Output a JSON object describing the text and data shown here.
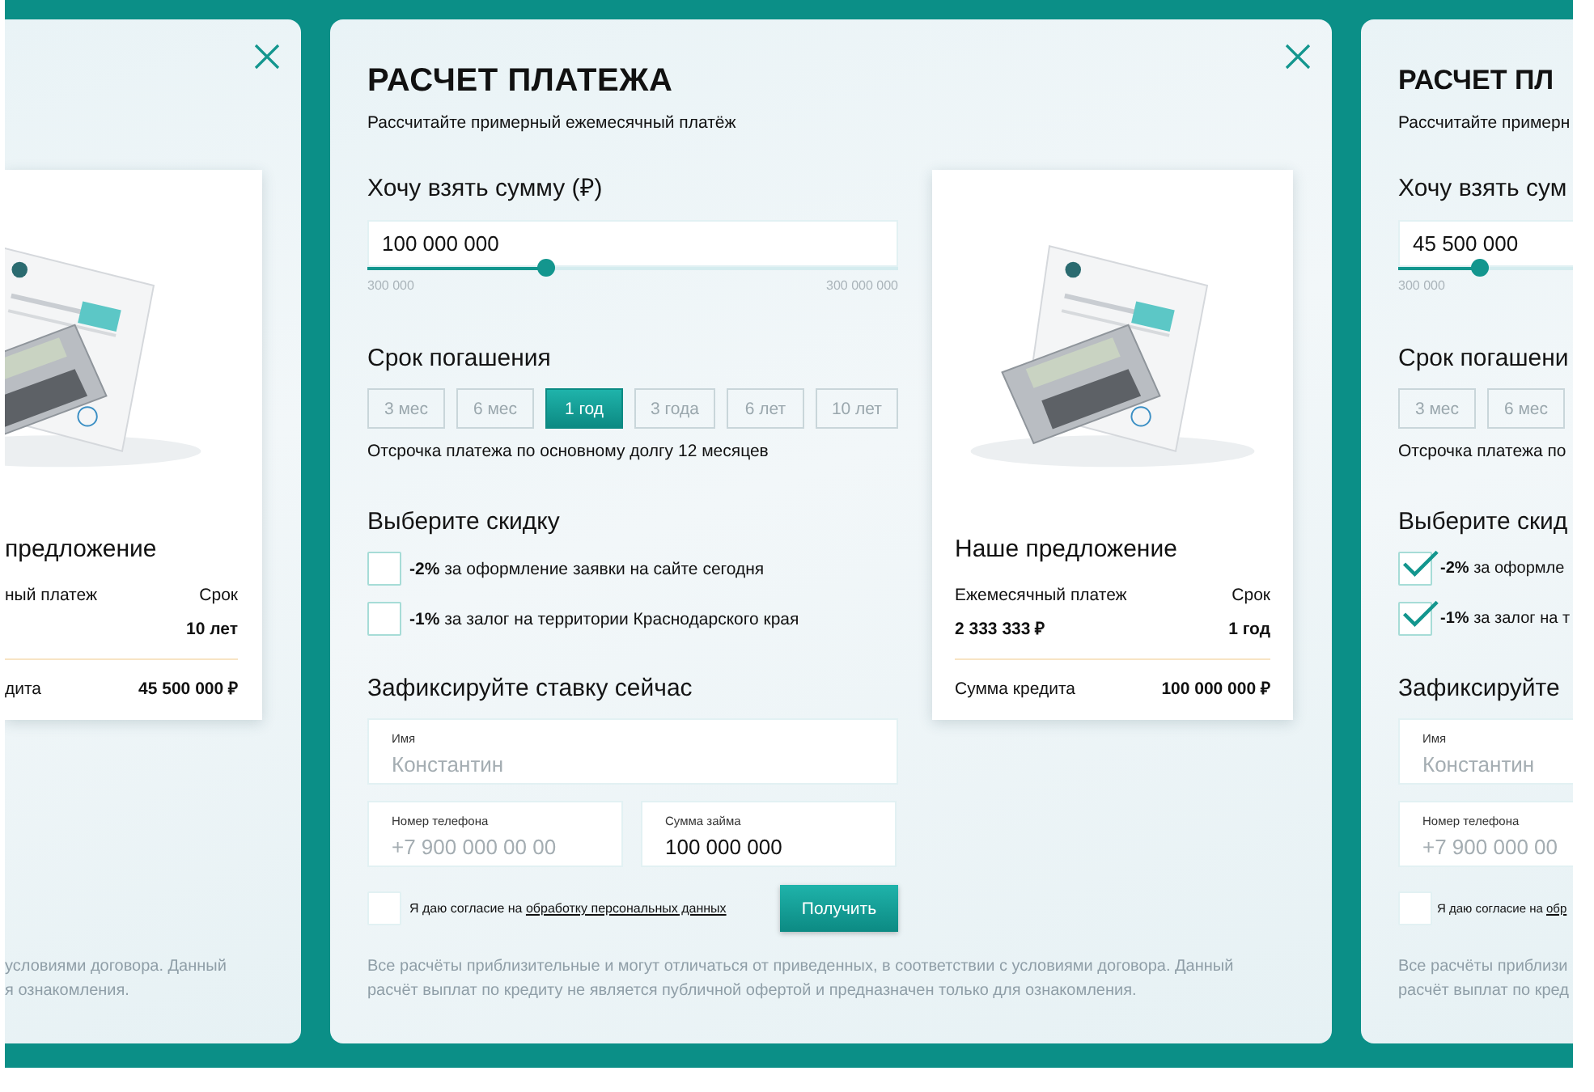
{
  "panels": [
    {
      "kind": "offer-only",
      "close": true,
      "offer": {
        "title": "предложение",
        "payment_label": "ный платеж",
        "term_label": "Срок",
        "term_value": "10 лет",
        "credit_label": "дита",
        "credit_value": "45 500 000 ₽"
      },
      "disclaimer_lines": [
        "условиями договора. Данный",
        "я ознакомления."
      ]
    },
    {
      "kind": "calculator",
      "close": true,
      "title": "РАСЧЕТ ПЛАТЕЖА",
      "subtitle": "Рассчитайте примерный ежемесячный платёж",
      "amount": {
        "label": "Хочу взять сумму (₽)",
        "value": "100 000 000",
        "level": 0.335,
        "min": "300 000",
        "max": "300 000 000"
      },
      "term": {
        "label": "Срок погашения",
        "options": [
          {
            "label": "3 мес",
            "selected": false
          },
          {
            "label": "6 мес",
            "selected": false
          },
          {
            "label": "1 год",
            "selected": true
          },
          {
            "label": "3 года",
            "selected": false
          },
          {
            "label": "6 лет",
            "selected": false
          },
          {
            "label": "10 лет",
            "selected": false
          }
        ],
        "note": "Отсрочка платежа по основному долгу 12 месяцев"
      },
      "discount": {
        "label": "Выберите скидку",
        "options": [
          {
            "text": "**-2%** за оформление заявки на сайте сегодня",
            "checked": false
          },
          {
            "text": "**-1%** за залог на территории Краснодарского края",
            "checked": false
          }
        ]
      },
      "fix": {
        "label": "Зафиксируйте ставку сейчас",
        "name": {
          "label": "Имя",
          "placeholder": "Константин"
        },
        "phone": {
          "label": "Номер телефона",
          "placeholder": "+7 900 000 00 00"
        },
        "sum": {
          "label": "Сумма займа",
          "value": "100 000 000"
        },
        "consent": {
          "checked": false,
          "text": "Я даю согласие на",
          "link": "обработку персональных данных"
        },
        "submit": "Получить"
      },
      "disclaimer_lines": [
        "Все расчёты приблизительные и могут отличаться от приведенных, в соответствии с условиями договора. Данный",
        "расчёт выплат по кредиту не является публичной офертой и предназначен только для ознакомления."
      ],
      "offer": {
        "title": "Наше предложение",
        "payment_label": "Ежемесячный платеж",
        "payment_value": "2 333 333 ₽",
        "term_label": "Срок",
        "term_value": "1 год",
        "credit_label": "Сумма кредита",
        "credit_value": "100 000 000 ₽"
      }
    },
    {
      "kind": "calculator",
      "close": false,
      "title": "РАСЧЕТ ПЛ",
      "subtitle": "Рассчитайте примерн",
      "amount": {
        "label": "Хочу взять сум",
        "value": "45 500 000",
        "level": 0.152,
        "min": "300 000"
      },
      "term": {
        "label": "Срок погашени",
        "options": [
          {
            "label": "3 мес",
            "selected": false
          },
          {
            "label": "6 мес",
            "selected": false
          }
        ],
        "note": "Отсрочка платежа по"
      },
      "discount": {
        "label": "Выберите скид",
        "options": [
          {
            "text": "**-2%** за оформле",
            "checked": true
          },
          {
            "text": "**-1%** за залог на т",
            "checked": true
          }
        ]
      },
      "fix": {
        "label": "Зафиксируйте",
        "name": {
          "label": "Имя",
          "placeholder": "Константин"
        },
        "phone": {
          "label": "Номер телефона",
          "placeholder": "+7 900 000 00"
        },
        "consent": {
          "checked": false,
          "text": "Я даю согласие на",
          "link": "обр"
        }
      },
      "disclaimer_lines": [
        "Все расчёты приблизи",
        "расчёт выплат по кред"
      ]
    }
  ]
}
